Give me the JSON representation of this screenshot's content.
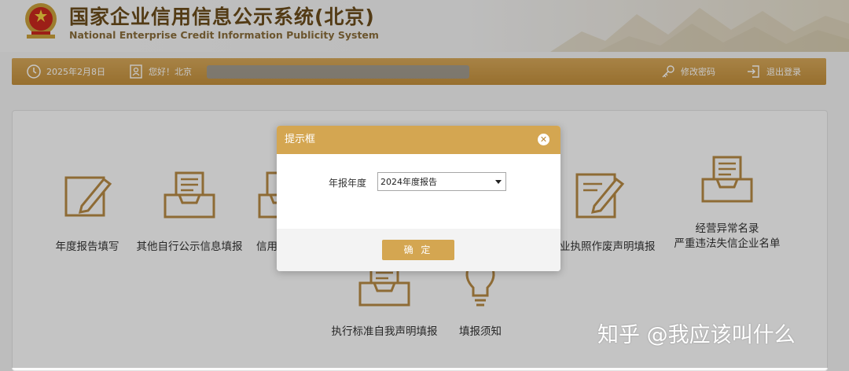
{
  "header": {
    "title": "国家企业信用信息公示系统(北京)",
    "subtitle": "National Enterprise Credit Information Publicity System"
  },
  "topbar": {
    "date": "2025年2月8日",
    "greeting": "您好！北京",
    "change_password": "修改密码",
    "logout": "退出登录"
  },
  "functions": [
    {
      "label": "年度报告填写",
      "icon": "edit-form-icon"
    },
    {
      "label": "其他自行公示信息填报",
      "icon": "inbox-document-icon"
    },
    {
      "label": "信用",
      "icon": "inbox-document-icon"
    },
    {
      "label": "业执照作废声明填报",
      "icon": "edit-form-icon"
    },
    {
      "label": "经营异常名录",
      "icon": "inbox-document-icon"
    },
    {
      "label": "严重违法失信企业名单",
      "icon": "inbox-document-icon"
    },
    {
      "label": "执行标准自我声明填报",
      "icon": "inbox-document-icon"
    },
    {
      "label": "填报须知",
      "icon": "lightbulb-icon"
    }
  ],
  "dialog": {
    "title": "提示框",
    "field_label": "年报年度",
    "select_value": "2024年度报告",
    "confirm_label": "确 定",
    "close_glyph": "✕"
  },
  "watermark": "知乎 @我应该叫什么",
  "colors": {
    "accent": "#d4a651",
    "brand_dark": "#6b4c1c"
  }
}
